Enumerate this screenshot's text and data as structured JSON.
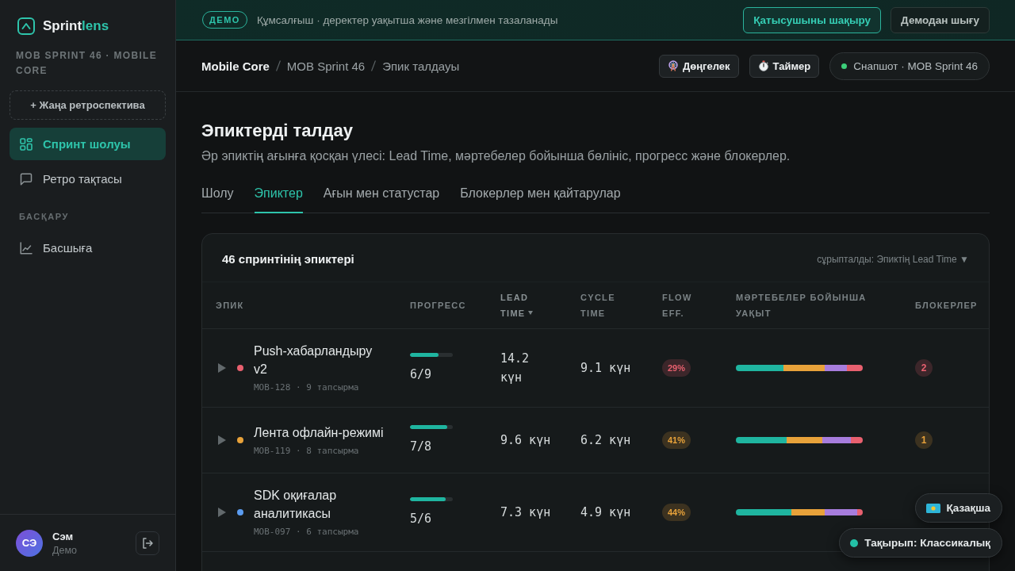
{
  "sidebar": {
    "logo": {
      "name": "Sprint",
      "accent": "lens"
    },
    "workspace": "MOB SPRINT 46 · MOBILE CORE",
    "new_button": "+ Жаңа ретроспектива",
    "nav": [
      {
        "label": "Спринт шолуы",
        "selected": true
      },
      {
        "label": "Ретро тақтасы",
        "selected": false
      }
    ],
    "section_label": "БАСҚАРУ",
    "section_items": [
      {
        "label": "Басшыға",
        "selected": false
      }
    ],
    "user": {
      "initials": "СЭ",
      "name": "Сэм",
      "role": "Демо"
    }
  },
  "banner": {
    "badge": "ДЕМО",
    "message": "Құмсалғыш · деректер уақытша және мезгілмен тазаланады",
    "buttons": [
      {
        "label": "Қатысушыны шақыру",
        "kind": "primary"
      },
      {
        "label": "Демодан шығу",
        "kind": "secondary"
      }
    ]
  },
  "header": {
    "breadcrumb": [
      "Mobile Core",
      "MOB Sprint 46",
      "Эпик талдауы"
    ],
    "tools": [
      {
        "label": "Дөңгелек"
      },
      {
        "label": "Таймер"
      }
    ],
    "snapshot": "Снапшот · MOB Sprint 46"
  },
  "page": {
    "title": "Эпиктерді талдау",
    "subtitle": "Әр эпиктің ағынға қосқан үлесі: Lead Time, мәртебелер бойынша бөлініс, прогресс және блокерлер.",
    "tabs": [
      {
        "label": "Шолу",
        "selected": false
      },
      {
        "label": "Эпиктер",
        "selected": true
      },
      {
        "label": "Ағын мен статустар",
        "selected": false
      },
      {
        "label": "Блокерлер мен қайтарулар",
        "selected": false
      }
    ],
    "epics": {
      "title": "46 спринтінің эпиктері",
      "sort_label": "сұрыпталды: Эпиктің Lead Time ▼",
      "columns": [
        {
          "label": "ЭПИК",
          "sorted": false
        },
        {
          "label": "ПРОГРЕСС",
          "sorted": false
        },
        {
          "label": "LEAD TIME",
          "sorted": true
        },
        {
          "label": "CYCLE TIME",
          "sorted": false
        },
        {
          "label": "FLOW EFF.",
          "sorted": false
        },
        {
          "label": "МӘРТЕБЕЛЕР БОЙЫНША УАҚЫТ",
          "sorted": false
        },
        {
          "label": "БЛОКЕРЛЕР",
          "sorted": false
        }
      ],
      "rows": [
        {
          "expanded": false,
          "color": "#e8606f",
          "title": "Push-хабарландыру v2",
          "meta": "MOB-128 · 9 тапсырма",
          "progress": {
            "level": 0.67,
            "text": "6/9"
          },
          "lead_time": "14.2 күн",
          "cycle_time": "9.1 күн",
          "flow_eff": {
            "text": "29%",
            "kind": "critical"
          },
          "blockers": {
            "text": "2",
            "kind": "critical"
          }
        },
        {
          "expanded": false,
          "color": "#e8a23a",
          "title": "Лента офлайн-режимі",
          "meta": "MOB-119 · 8 тапсырма",
          "progress": {
            "level": 0.875,
            "text": "7/8"
          },
          "lead_time": "9.6 күн",
          "cycle_time": "6.2 күн",
          "flow_eff": {
            "text": "41%",
            "kind": "warning"
          },
          "blockers": {
            "text": "1",
            "kind": "warning"
          }
        },
        {
          "expanded": false,
          "color": "#5b9cf0",
          "title": "SDK оқиғалар аналитикасы",
          "meta": "MOB-097 · 6 тапсырма",
          "progress": {
            "level": 0.83,
            "text": "5/6"
          },
          "lead_time": "7.3 күн",
          "cycle_time": "4.9 күн",
          "flow_eff": {
            "text": "44%",
            "kind": "warning"
          }
        }
      ]
    }
  },
  "floating": {
    "language": "Қазақша",
    "theme": "Тақырып: Классикалық"
  }
}
